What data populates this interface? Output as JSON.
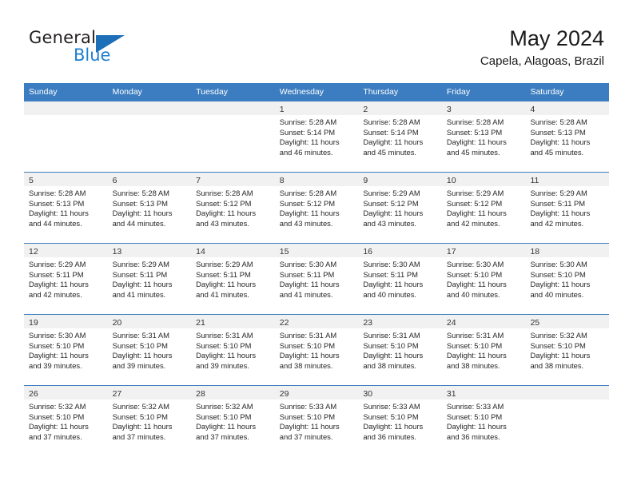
{
  "brand": {
    "name_part1": "General",
    "name_part2": "Blue",
    "triangle_color": "#1d6fb8",
    "blue_text_color": "#1d7fd1"
  },
  "header": {
    "title": "May 2024",
    "subtitle": "Capela, Alagoas, Brazil"
  },
  "theme": {
    "header_row_bg": "#3b7dc0",
    "daynum_band_bg": "#f1f1f1",
    "grid_line": "#3b7dc0"
  },
  "weekdays": [
    "Sunday",
    "Monday",
    "Tuesday",
    "Wednesday",
    "Thursday",
    "Friday",
    "Saturday"
  ],
  "weeks": [
    [
      {
        "day": "",
        "empty": true,
        "sunrise": "",
        "sunset": "",
        "daylight1": "",
        "daylight2": ""
      },
      {
        "day": "",
        "empty": true,
        "sunrise": "",
        "sunset": "",
        "daylight1": "",
        "daylight2": ""
      },
      {
        "day": "",
        "empty": true,
        "sunrise": "",
        "sunset": "",
        "daylight1": "",
        "daylight2": ""
      },
      {
        "day": "1",
        "empty": false,
        "sunrise": "Sunrise: 5:28 AM",
        "sunset": "Sunset: 5:14 PM",
        "daylight1": "Daylight: 11 hours",
        "daylight2": "and 46 minutes."
      },
      {
        "day": "2",
        "empty": false,
        "sunrise": "Sunrise: 5:28 AM",
        "sunset": "Sunset: 5:14 PM",
        "daylight1": "Daylight: 11 hours",
        "daylight2": "and 45 minutes."
      },
      {
        "day": "3",
        "empty": false,
        "sunrise": "Sunrise: 5:28 AM",
        "sunset": "Sunset: 5:13 PM",
        "daylight1": "Daylight: 11 hours",
        "daylight2": "and 45 minutes."
      },
      {
        "day": "4",
        "empty": false,
        "sunrise": "Sunrise: 5:28 AM",
        "sunset": "Sunset: 5:13 PM",
        "daylight1": "Daylight: 11 hours",
        "daylight2": "and 45 minutes."
      }
    ],
    [
      {
        "day": "5",
        "empty": false,
        "sunrise": "Sunrise: 5:28 AM",
        "sunset": "Sunset: 5:13 PM",
        "daylight1": "Daylight: 11 hours",
        "daylight2": "and 44 minutes."
      },
      {
        "day": "6",
        "empty": false,
        "sunrise": "Sunrise: 5:28 AM",
        "sunset": "Sunset: 5:13 PM",
        "daylight1": "Daylight: 11 hours",
        "daylight2": "and 44 minutes."
      },
      {
        "day": "7",
        "empty": false,
        "sunrise": "Sunrise: 5:28 AM",
        "sunset": "Sunset: 5:12 PM",
        "daylight1": "Daylight: 11 hours",
        "daylight2": "and 43 minutes."
      },
      {
        "day": "8",
        "empty": false,
        "sunrise": "Sunrise: 5:28 AM",
        "sunset": "Sunset: 5:12 PM",
        "daylight1": "Daylight: 11 hours",
        "daylight2": "and 43 minutes."
      },
      {
        "day": "9",
        "empty": false,
        "sunrise": "Sunrise: 5:29 AM",
        "sunset": "Sunset: 5:12 PM",
        "daylight1": "Daylight: 11 hours",
        "daylight2": "and 43 minutes."
      },
      {
        "day": "10",
        "empty": false,
        "sunrise": "Sunrise: 5:29 AM",
        "sunset": "Sunset: 5:12 PM",
        "daylight1": "Daylight: 11 hours",
        "daylight2": "and 42 minutes."
      },
      {
        "day": "11",
        "empty": false,
        "sunrise": "Sunrise: 5:29 AM",
        "sunset": "Sunset: 5:11 PM",
        "daylight1": "Daylight: 11 hours",
        "daylight2": "and 42 minutes."
      }
    ],
    [
      {
        "day": "12",
        "empty": false,
        "sunrise": "Sunrise: 5:29 AM",
        "sunset": "Sunset: 5:11 PM",
        "daylight1": "Daylight: 11 hours",
        "daylight2": "and 42 minutes."
      },
      {
        "day": "13",
        "empty": false,
        "sunrise": "Sunrise: 5:29 AM",
        "sunset": "Sunset: 5:11 PM",
        "daylight1": "Daylight: 11 hours",
        "daylight2": "and 41 minutes."
      },
      {
        "day": "14",
        "empty": false,
        "sunrise": "Sunrise: 5:29 AM",
        "sunset": "Sunset: 5:11 PM",
        "daylight1": "Daylight: 11 hours",
        "daylight2": "and 41 minutes."
      },
      {
        "day": "15",
        "empty": false,
        "sunrise": "Sunrise: 5:30 AM",
        "sunset": "Sunset: 5:11 PM",
        "daylight1": "Daylight: 11 hours",
        "daylight2": "and 41 minutes."
      },
      {
        "day": "16",
        "empty": false,
        "sunrise": "Sunrise: 5:30 AM",
        "sunset": "Sunset: 5:11 PM",
        "daylight1": "Daylight: 11 hours",
        "daylight2": "and 40 minutes."
      },
      {
        "day": "17",
        "empty": false,
        "sunrise": "Sunrise: 5:30 AM",
        "sunset": "Sunset: 5:10 PM",
        "daylight1": "Daylight: 11 hours",
        "daylight2": "and 40 minutes."
      },
      {
        "day": "18",
        "empty": false,
        "sunrise": "Sunrise: 5:30 AM",
        "sunset": "Sunset: 5:10 PM",
        "daylight1": "Daylight: 11 hours",
        "daylight2": "and 40 minutes."
      }
    ],
    [
      {
        "day": "19",
        "empty": false,
        "sunrise": "Sunrise: 5:30 AM",
        "sunset": "Sunset: 5:10 PM",
        "daylight1": "Daylight: 11 hours",
        "daylight2": "and 39 minutes."
      },
      {
        "day": "20",
        "empty": false,
        "sunrise": "Sunrise: 5:31 AM",
        "sunset": "Sunset: 5:10 PM",
        "daylight1": "Daylight: 11 hours",
        "daylight2": "and 39 minutes."
      },
      {
        "day": "21",
        "empty": false,
        "sunrise": "Sunrise: 5:31 AM",
        "sunset": "Sunset: 5:10 PM",
        "daylight1": "Daylight: 11 hours",
        "daylight2": "and 39 minutes."
      },
      {
        "day": "22",
        "empty": false,
        "sunrise": "Sunrise: 5:31 AM",
        "sunset": "Sunset: 5:10 PM",
        "daylight1": "Daylight: 11 hours",
        "daylight2": "and 38 minutes."
      },
      {
        "day": "23",
        "empty": false,
        "sunrise": "Sunrise: 5:31 AM",
        "sunset": "Sunset: 5:10 PM",
        "daylight1": "Daylight: 11 hours",
        "daylight2": "and 38 minutes."
      },
      {
        "day": "24",
        "empty": false,
        "sunrise": "Sunrise: 5:31 AM",
        "sunset": "Sunset: 5:10 PM",
        "daylight1": "Daylight: 11 hours",
        "daylight2": "and 38 minutes."
      },
      {
        "day": "25",
        "empty": false,
        "sunrise": "Sunrise: 5:32 AM",
        "sunset": "Sunset: 5:10 PM",
        "daylight1": "Daylight: 11 hours",
        "daylight2": "and 38 minutes."
      }
    ],
    [
      {
        "day": "26",
        "empty": false,
        "sunrise": "Sunrise: 5:32 AM",
        "sunset": "Sunset: 5:10 PM",
        "daylight1": "Daylight: 11 hours",
        "daylight2": "and 37 minutes."
      },
      {
        "day": "27",
        "empty": false,
        "sunrise": "Sunrise: 5:32 AM",
        "sunset": "Sunset: 5:10 PM",
        "daylight1": "Daylight: 11 hours",
        "daylight2": "and 37 minutes."
      },
      {
        "day": "28",
        "empty": false,
        "sunrise": "Sunrise: 5:32 AM",
        "sunset": "Sunset: 5:10 PM",
        "daylight1": "Daylight: 11 hours",
        "daylight2": "and 37 minutes."
      },
      {
        "day": "29",
        "empty": false,
        "sunrise": "Sunrise: 5:33 AM",
        "sunset": "Sunset: 5:10 PM",
        "daylight1": "Daylight: 11 hours",
        "daylight2": "and 37 minutes."
      },
      {
        "day": "30",
        "empty": false,
        "sunrise": "Sunrise: 5:33 AM",
        "sunset": "Sunset: 5:10 PM",
        "daylight1": "Daylight: 11 hours",
        "daylight2": "and 36 minutes."
      },
      {
        "day": "31",
        "empty": false,
        "sunrise": "Sunrise: 5:33 AM",
        "sunset": "Sunset: 5:10 PM",
        "daylight1": "Daylight: 11 hours",
        "daylight2": "and 36 minutes."
      },
      {
        "day": "",
        "empty": true,
        "sunrise": "",
        "sunset": "",
        "daylight1": "",
        "daylight2": ""
      }
    ]
  ]
}
